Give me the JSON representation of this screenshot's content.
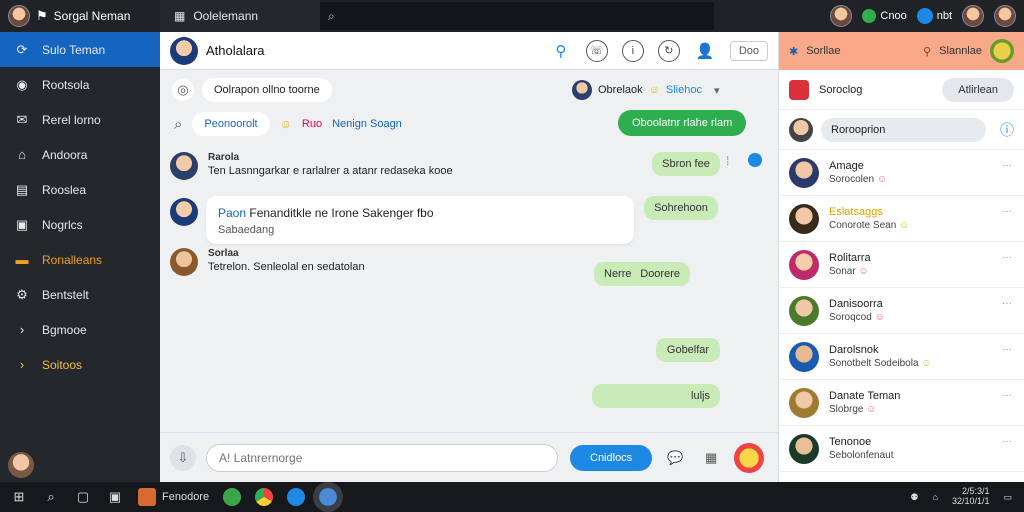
{
  "topbar": {
    "app_name": "Sorgal Neman",
    "tab_name": "Oolelemann",
    "status_label": "Cnoo",
    "notify_label": "nbt"
  },
  "sidebar": {
    "items": [
      {
        "label": "Sulo Teman",
        "icon": "refresh-icon",
        "active": true
      },
      {
        "label": "Rootsola",
        "icon": "compass-icon"
      },
      {
        "label": "Rerel lorno",
        "icon": "mail-icon"
      },
      {
        "label": "Andoora",
        "icon": "home-icon"
      },
      {
        "label": "Rooslea",
        "icon": "document-icon"
      },
      {
        "label": "Nogrlcs",
        "icon": "photo-icon"
      },
      {
        "label": "Ronalleans",
        "icon": "folder-icon",
        "accent": true
      },
      {
        "label": "Bentstelt",
        "icon": "settings-icon"
      },
      {
        "label": "Bgmooe",
        "icon": "chevron-right-icon"
      },
      {
        "label": "Soitoos",
        "icon": "chevron-right-icon",
        "accent": true
      }
    ]
  },
  "chat": {
    "title": "Atholalara",
    "header_box": "Doo",
    "top_pill": "Oolrapon ollno toorne",
    "right_user": "Obrelaok",
    "right_link": "Sliehoc",
    "search_pill": "Peonoorolt",
    "search_tag": "Nenign Soagn",
    "search_emoji": "Ruo",
    "green_button": "Oboolatnr rlahe rlam",
    "messages": [
      {
        "name": "Rarola",
        "text": "Ten Lasnngarkar e rarlalrer a atanr redaseka kooe"
      },
      {
        "name": "Paon",
        "text": "Fenanditkle ne Irone Sakenger fbo",
        "sub": "Sabaedang"
      },
      {
        "name": "Sorlaa",
        "text": "Tetrelon. Senleolal en sedatolan"
      }
    ],
    "green_bubbles": [
      "Sbron fee",
      "Sohrehoon",
      "Nerre",
      "Doorere",
      "Gobelfar",
      "luljs"
    ],
    "composer_placeholder": "A! Latnrernorge",
    "send_label": "Cnidlocs"
  },
  "right_panel": {
    "header_left": "Sorllae",
    "header_right": "Slannlae",
    "search_label": "Soroclog",
    "search_button": "Atlirlean",
    "filter_label": "Rorooprion",
    "contacts": [
      {
        "name": "Amage",
        "sub": "Sorocolen"
      },
      {
        "name": "Eslatsaggs",
        "sub": "Conorote Sean",
        "accent": true
      },
      {
        "name": "Rolitarra",
        "sub": "Sonar"
      },
      {
        "name": "Danisoorra",
        "sub": "Soroqcod"
      },
      {
        "name": "Darolsnok",
        "sub": "Sonotbelt Sodeibola"
      },
      {
        "name": "Danate Teman",
        "sub": "Slobrge"
      },
      {
        "name": "Tenonoe",
        "sub": "Sebolonfenaut"
      }
    ]
  },
  "taskbar": {
    "app_label": "Fenodore",
    "time": "2/5:3/1",
    "date": "32/10/1/1"
  }
}
